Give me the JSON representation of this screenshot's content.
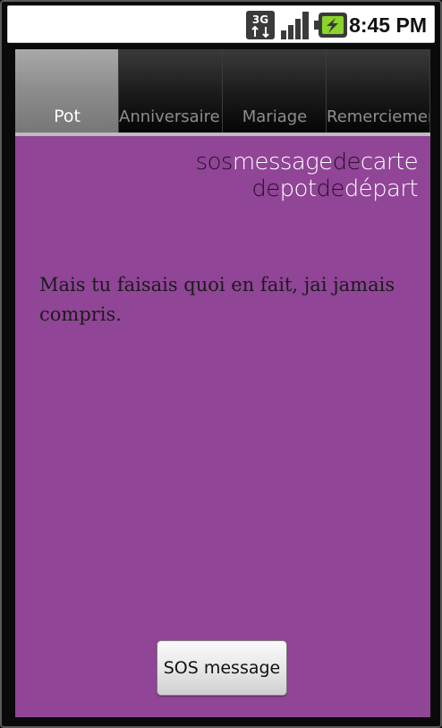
{
  "status_bar": {
    "time": "8:45 PM",
    "network_label": "3G",
    "icons": [
      "3g-data-icon",
      "signal-strength-icon",
      "battery-charging-icon"
    ]
  },
  "tabs": [
    {
      "label": "Pot",
      "active": true
    },
    {
      "label": "Anniversaire",
      "active": false
    },
    {
      "label": "Mariage",
      "active": false
    },
    {
      "label": "Remerciements",
      "active": false
    }
  ],
  "logo": {
    "line1": [
      {
        "text": "sos",
        "tone": "dark"
      },
      {
        "text": "message",
        "tone": "light"
      },
      {
        "text": "de",
        "tone": "dark"
      },
      {
        "text": "carte",
        "tone": "light"
      }
    ],
    "line2": [
      {
        "text": "de",
        "tone": "dark"
      },
      {
        "text": "pot",
        "tone": "light"
      },
      {
        "text": "de",
        "tone": "dark"
      },
      {
        "text": "départ",
        "tone": "light"
      }
    ]
  },
  "message_text": "Mais tu faisais quoi en fait, jai jamais compris.",
  "sos_button_label": "SOS message",
  "colors": {
    "content_background": "#904596",
    "logo_dark": "#2b0f2c",
    "logo_light": "#ffffff"
  }
}
